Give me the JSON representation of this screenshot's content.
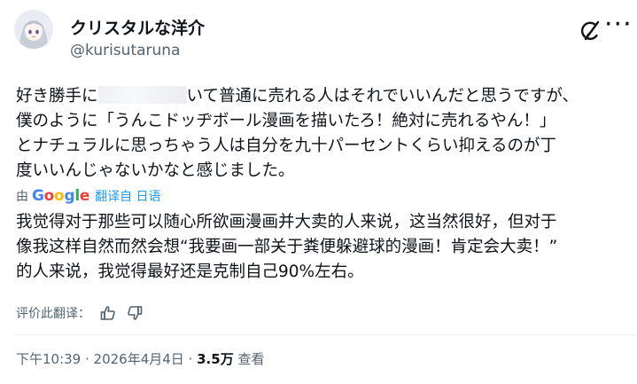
{
  "author": {
    "display_name": "クリスタルな洋介",
    "handle": "@kurisutaruna"
  },
  "icons": {
    "avatar": "anime-avatar",
    "grok": "grok-icon",
    "more": "more-icon",
    "like": "thumbs-up-icon",
    "dislike": "thumbs-down-icon"
  },
  "tweet": {
    "line1_start": "好き勝手に",
    "line1_end": "いて普通に売れる人はそれでいいんだと思うですが、",
    "line2": "僕のように「うんこドッヂボール漫画を描いたろ！絶対に売れるやん！」",
    "line3": "とナチュラルに思っちゃう人は自分を九十パーセントくらい抑えるのが丁",
    "line4": "度いいんじゃないかなと感じました。"
  },
  "translation": {
    "by_label": "由",
    "google_label": "Google",
    "translated_from": "翻译自 日语",
    "lines": [
      "我觉得对于那些可以随心所欲画漫画并大卖的人来说，这当然很好，但对于",
      "像我这样自然而然会想“我要画一部关于粪便躲避球的漫画！肯定会大卖！”",
      "的人来说，我觉得最好还是克制自己90%左右。"
    ],
    "rate_label": "评价此翻译："
  },
  "meta": {
    "time": "下午10:39",
    "sep1": " · ",
    "date": "2026年4月4日",
    "sep2": " · ",
    "views_count": "3.5万",
    "views_label": " 查看"
  }
}
